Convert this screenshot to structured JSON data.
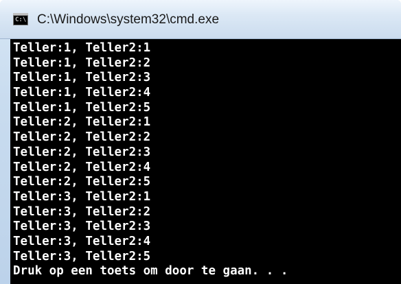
{
  "window": {
    "title": "C:\\Windows\\system32\\cmd.exe",
    "icon": "cmd-console-icon",
    "icon_glyph": "C:\\"
  },
  "console": {
    "lines": [
      "Teller:1, Teller2:1",
      "Teller:1, Teller2:2",
      "Teller:1, Teller2:3",
      "Teller:1, Teller2:4",
      "Teller:1, Teller2:5",
      "Teller:2, Teller2:1",
      "Teller:2, Teller2:2",
      "Teller:2, Teller2:3",
      "Teller:2, Teller2:4",
      "Teller:2, Teller2:5",
      "Teller:3, Teller2:1",
      "Teller:3, Teller2:2",
      "Teller:3, Teller2:3",
      "Teller:3, Teller2:4",
      "Teller:3, Teller2:5",
      "Druk op een toets om door te gaan. . ."
    ]
  },
  "colors": {
    "console_background": "#000000",
    "console_text": "#ffffff"
  }
}
